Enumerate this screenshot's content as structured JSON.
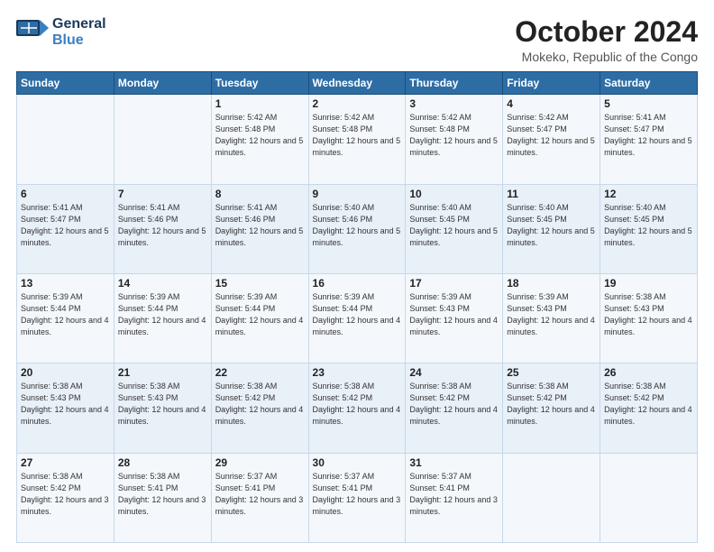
{
  "logo": {
    "line1": "General",
    "line2": "Blue"
  },
  "title": "October 2024",
  "location": "Mokeko, Republic of the Congo",
  "weekdays": [
    "Sunday",
    "Monday",
    "Tuesday",
    "Wednesday",
    "Thursday",
    "Friday",
    "Saturday"
  ],
  "weeks": [
    [
      {
        "day": "",
        "info": ""
      },
      {
        "day": "",
        "info": ""
      },
      {
        "day": "1",
        "info": "Sunrise: 5:42 AM\nSunset: 5:48 PM\nDaylight: 12 hours and 5 minutes."
      },
      {
        "day": "2",
        "info": "Sunrise: 5:42 AM\nSunset: 5:48 PM\nDaylight: 12 hours and 5 minutes."
      },
      {
        "day": "3",
        "info": "Sunrise: 5:42 AM\nSunset: 5:48 PM\nDaylight: 12 hours and 5 minutes."
      },
      {
        "day": "4",
        "info": "Sunrise: 5:42 AM\nSunset: 5:47 PM\nDaylight: 12 hours and 5 minutes."
      },
      {
        "day": "5",
        "info": "Sunrise: 5:41 AM\nSunset: 5:47 PM\nDaylight: 12 hours and 5 minutes."
      }
    ],
    [
      {
        "day": "6",
        "info": "Sunrise: 5:41 AM\nSunset: 5:47 PM\nDaylight: 12 hours and 5 minutes."
      },
      {
        "day": "7",
        "info": "Sunrise: 5:41 AM\nSunset: 5:46 PM\nDaylight: 12 hours and 5 minutes."
      },
      {
        "day": "8",
        "info": "Sunrise: 5:41 AM\nSunset: 5:46 PM\nDaylight: 12 hours and 5 minutes."
      },
      {
        "day": "9",
        "info": "Sunrise: 5:40 AM\nSunset: 5:46 PM\nDaylight: 12 hours and 5 minutes."
      },
      {
        "day": "10",
        "info": "Sunrise: 5:40 AM\nSunset: 5:45 PM\nDaylight: 12 hours and 5 minutes."
      },
      {
        "day": "11",
        "info": "Sunrise: 5:40 AM\nSunset: 5:45 PM\nDaylight: 12 hours and 5 minutes."
      },
      {
        "day": "12",
        "info": "Sunrise: 5:40 AM\nSunset: 5:45 PM\nDaylight: 12 hours and 5 minutes."
      }
    ],
    [
      {
        "day": "13",
        "info": "Sunrise: 5:39 AM\nSunset: 5:44 PM\nDaylight: 12 hours and 4 minutes."
      },
      {
        "day": "14",
        "info": "Sunrise: 5:39 AM\nSunset: 5:44 PM\nDaylight: 12 hours and 4 minutes."
      },
      {
        "day": "15",
        "info": "Sunrise: 5:39 AM\nSunset: 5:44 PM\nDaylight: 12 hours and 4 minutes."
      },
      {
        "day": "16",
        "info": "Sunrise: 5:39 AM\nSunset: 5:44 PM\nDaylight: 12 hours and 4 minutes."
      },
      {
        "day": "17",
        "info": "Sunrise: 5:39 AM\nSunset: 5:43 PM\nDaylight: 12 hours and 4 minutes."
      },
      {
        "day": "18",
        "info": "Sunrise: 5:39 AM\nSunset: 5:43 PM\nDaylight: 12 hours and 4 minutes."
      },
      {
        "day": "19",
        "info": "Sunrise: 5:38 AM\nSunset: 5:43 PM\nDaylight: 12 hours and 4 minutes."
      }
    ],
    [
      {
        "day": "20",
        "info": "Sunrise: 5:38 AM\nSunset: 5:43 PM\nDaylight: 12 hours and 4 minutes."
      },
      {
        "day": "21",
        "info": "Sunrise: 5:38 AM\nSunset: 5:43 PM\nDaylight: 12 hours and 4 minutes."
      },
      {
        "day": "22",
        "info": "Sunrise: 5:38 AM\nSunset: 5:42 PM\nDaylight: 12 hours and 4 minutes."
      },
      {
        "day": "23",
        "info": "Sunrise: 5:38 AM\nSunset: 5:42 PM\nDaylight: 12 hours and 4 minutes."
      },
      {
        "day": "24",
        "info": "Sunrise: 5:38 AM\nSunset: 5:42 PM\nDaylight: 12 hours and 4 minutes."
      },
      {
        "day": "25",
        "info": "Sunrise: 5:38 AM\nSunset: 5:42 PM\nDaylight: 12 hours and 4 minutes."
      },
      {
        "day": "26",
        "info": "Sunrise: 5:38 AM\nSunset: 5:42 PM\nDaylight: 12 hours and 4 minutes."
      }
    ],
    [
      {
        "day": "27",
        "info": "Sunrise: 5:38 AM\nSunset: 5:42 PM\nDaylight: 12 hours and 3 minutes."
      },
      {
        "day": "28",
        "info": "Sunrise: 5:38 AM\nSunset: 5:41 PM\nDaylight: 12 hours and 3 minutes."
      },
      {
        "day": "29",
        "info": "Sunrise: 5:37 AM\nSunset: 5:41 PM\nDaylight: 12 hours and 3 minutes."
      },
      {
        "day": "30",
        "info": "Sunrise: 5:37 AM\nSunset: 5:41 PM\nDaylight: 12 hours and 3 minutes."
      },
      {
        "day": "31",
        "info": "Sunrise: 5:37 AM\nSunset: 5:41 PM\nDaylight: 12 hours and 3 minutes."
      },
      {
        "day": "",
        "info": ""
      },
      {
        "day": "",
        "info": ""
      }
    ]
  ]
}
